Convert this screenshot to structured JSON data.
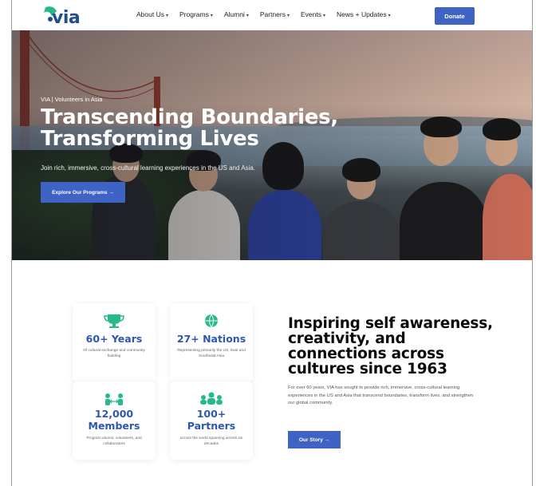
{
  "header": {
    "logo_text": "via",
    "nav": [
      {
        "label": "About Us"
      },
      {
        "label": "Programs"
      },
      {
        "label": "Alumni"
      },
      {
        "label": "Partners"
      },
      {
        "label": "Events"
      },
      {
        "label": "News + Updates"
      }
    ],
    "donate_label": "Donate"
  },
  "hero": {
    "eyebrow": "VIA | Volunteers in Asia",
    "title_line1": "Transcending Boundaries,",
    "title_line2": "Transforming Lives",
    "subtitle": "Join rich, immersive, cross-cultural learning experiences in the US and Asia.",
    "button_label": "Explore Our Programs →"
  },
  "stats": [
    {
      "icon": "trophy-icon",
      "value": "60+ Years",
      "caption": "Of cultural exchange and community building"
    },
    {
      "icon": "globe-icon",
      "value": "27+ Nations",
      "caption": "Representing primarily the US, East and Southeast Asia"
    },
    {
      "icon": "people-arrows-icon",
      "value_line1": "12,000",
      "value_line2": "Members",
      "caption": "Program alumni, volunteers, and collaborators"
    },
    {
      "icon": "group-icon",
      "value_line1": "100+",
      "value_line2": "Partners",
      "caption": "across the world spanning across six decades"
    }
  ],
  "about": {
    "title": "Inspiring self awareness, creativity, and connections across cultures since 1963",
    "body": "For over 60 years, VIA has sought to provide rich, immersive, cross-cultural learning experiences in the US and Asia that transcend boundaries, transform lives, and strengthen our global community.",
    "button_label": "Our Story →"
  },
  "colors": {
    "accent": "#3f63c4",
    "stat_blue": "#2f56b3",
    "icon_green": "#27b98a"
  }
}
